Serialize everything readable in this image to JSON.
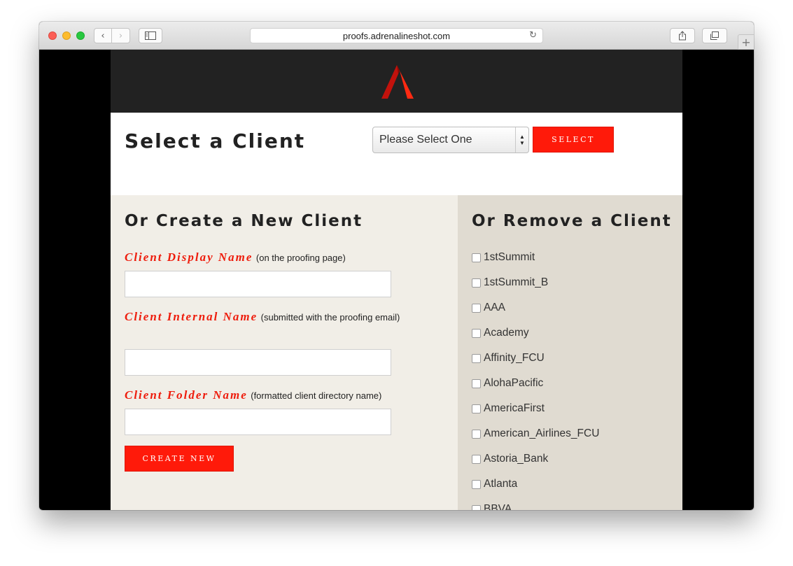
{
  "browser": {
    "url": "proofs.adrenalineshot.com",
    "back_icon": "‹",
    "forward_icon": "›",
    "reload_icon": "↻",
    "newtab_icon": "+"
  },
  "colors": {
    "accent": "#ff1a0a",
    "header_bg": "#222222",
    "create_bg": "#f1eee7",
    "remove_bg": "#e0dbd1"
  },
  "select_section": {
    "title": "Select a Client",
    "dropdown_value": "Please Select One",
    "select_button": "SELECT"
  },
  "create_section": {
    "title": "Or Create a New Client",
    "fields": [
      {
        "label": "Client Display Name",
        "hint": "(on the proofing page)"
      },
      {
        "label": "Client Internal Name",
        "hint": "(submitted with the proofing email)"
      },
      {
        "label": "Client Folder Name",
        "hint": "(formatted client directory name)"
      }
    ],
    "create_button": "CREATE NEW"
  },
  "remove_section": {
    "title": "Or Remove a Client",
    "clients": [
      "1stSummit",
      "1stSummit_B",
      "AAA",
      "Academy",
      "Affinity_FCU",
      "AlohaPacific",
      "AmericaFirst",
      "American_Airlines_FCU",
      "Astoria_Bank",
      "Atlanta",
      "BBVA"
    ]
  }
}
